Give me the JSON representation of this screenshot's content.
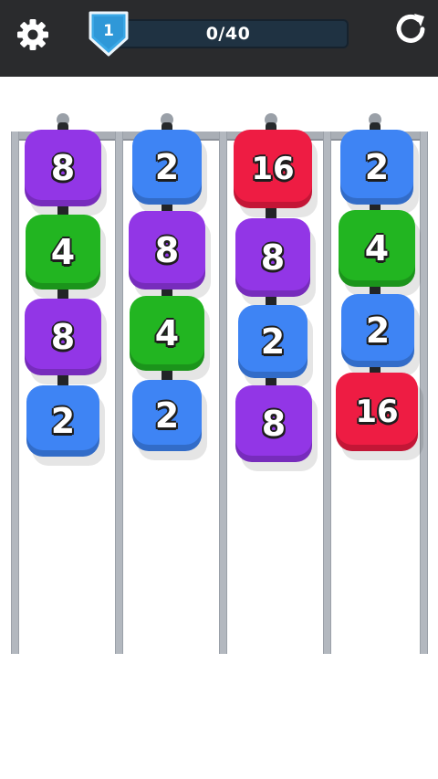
{
  "header": {
    "level": "1",
    "progress_text": "0/40",
    "progress_fraction": 0.0,
    "settings_icon": "gear-icon",
    "restart_icon": "restart-icon"
  },
  "colors": {
    "2": "#3e84f4",
    "4": "#22b521",
    "8": "#9236e6",
    "16": "#ee1c43"
  },
  "columns": [
    {
      "blocks": [
        "8",
        "4",
        "8",
        "2"
      ]
    },
    {
      "blocks": [
        "2",
        "8",
        "4",
        "2"
      ]
    },
    {
      "blocks": [
        "16",
        "8",
        "2",
        "8"
      ]
    },
    {
      "blocks": [
        "2",
        "4",
        "2",
        "16"
      ]
    }
  ]
}
